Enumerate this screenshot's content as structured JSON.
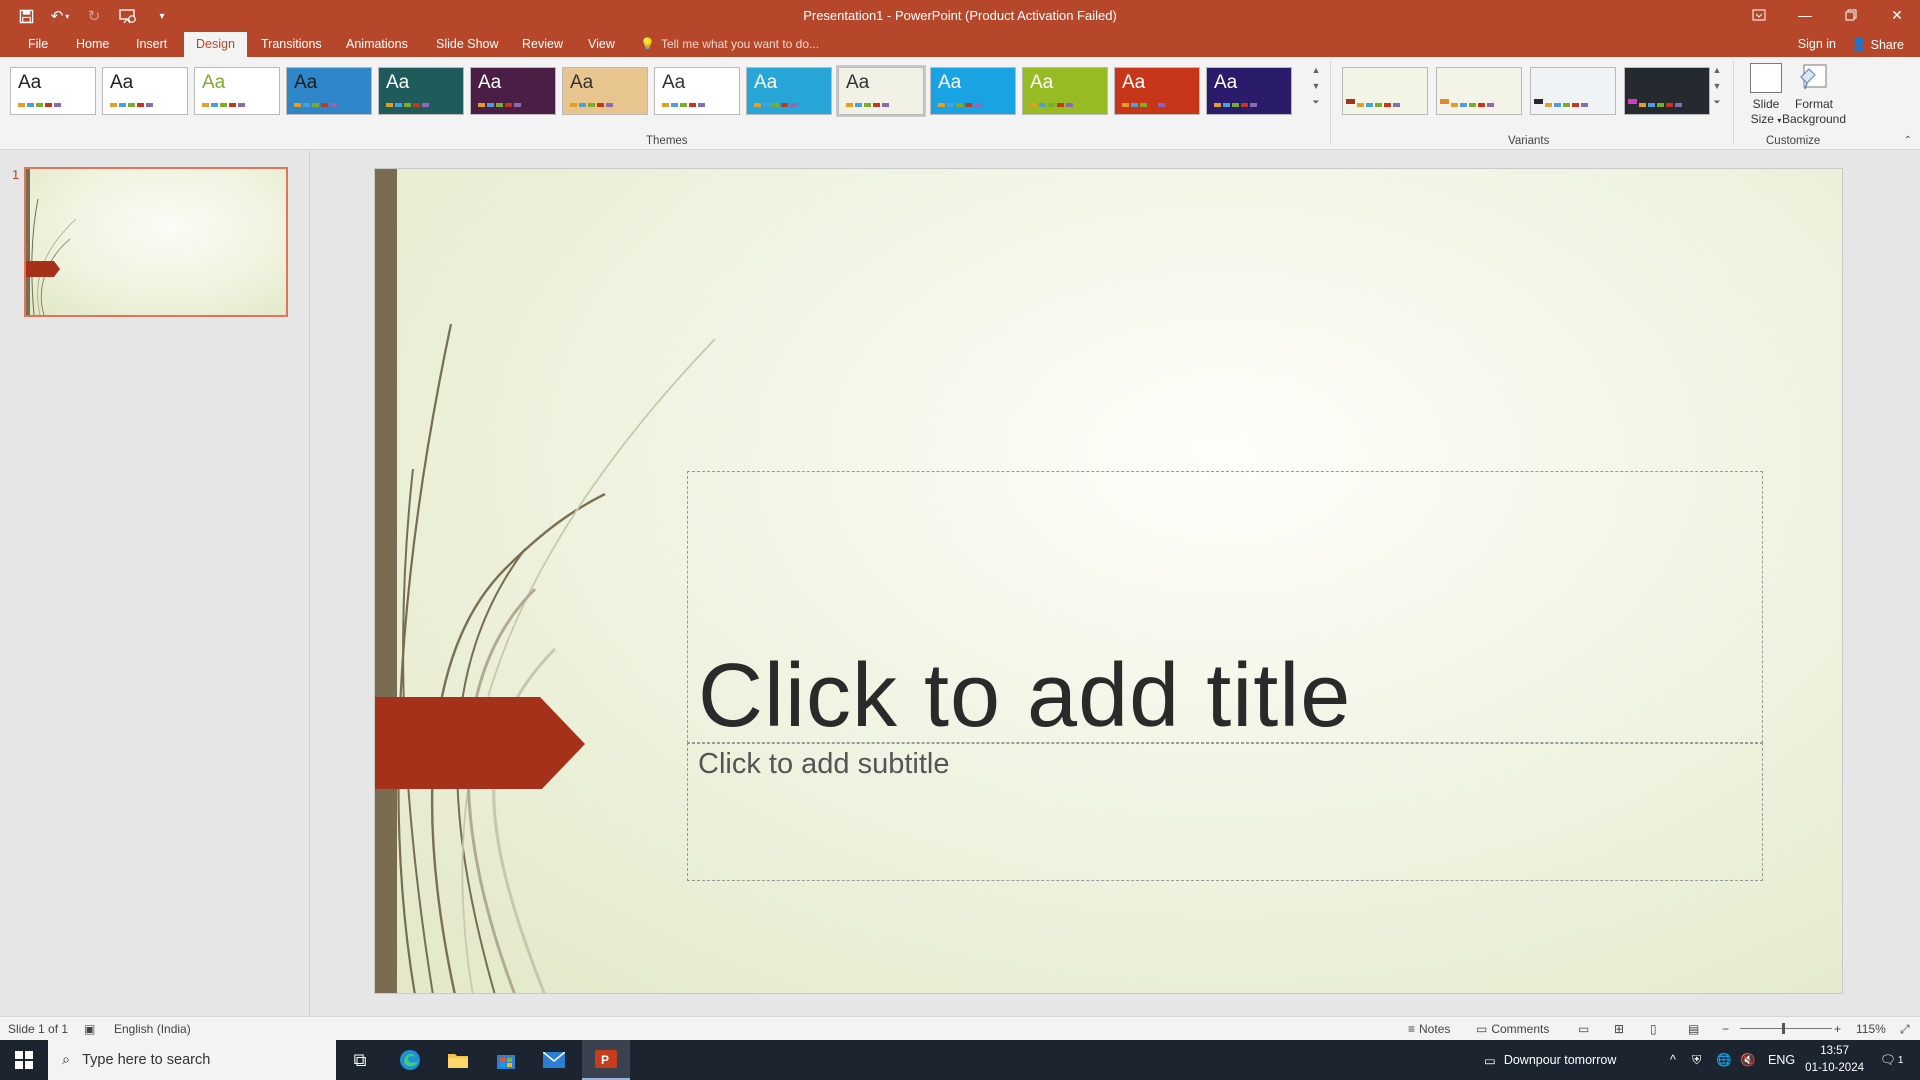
{
  "window": {
    "title": "Presentation1 - PowerPoint (Product Activation Failed)"
  },
  "tabs": [
    {
      "label": "File"
    },
    {
      "label": "Home"
    },
    {
      "label": "Insert"
    },
    {
      "label": "Design",
      "active": true
    },
    {
      "label": "Transitions"
    },
    {
      "label": "Animations"
    },
    {
      "label": "Slide Show"
    },
    {
      "label": "Review"
    },
    {
      "label": "View"
    }
  ],
  "tellme": {
    "placeholder": "Tell me what you want to do..."
  },
  "account": {
    "signin": "Sign in",
    "share": "Share"
  },
  "ribbon": {
    "themes_label": "Themes",
    "variants_label": "Variants",
    "customize_label": "Customize",
    "theme_sample": "Aa",
    "slide_size": "Slide Size",
    "format_background": "Format Background",
    "themes": [
      {
        "name": "office-theme",
        "bg": "#ffffff",
        "fg": "#222222"
      },
      {
        "name": "office",
        "bg": "#ffffff",
        "fg": "#222222"
      },
      {
        "name": "facet",
        "bg": "#ffffff",
        "fg": "#7dab2b"
      },
      {
        "name": "integral",
        "bg": "#2f86c9",
        "fg": "#1b1b1b"
      },
      {
        "name": "ion-boardroom",
        "bg": "#1f5b5b",
        "fg": "#ffffff"
      },
      {
        "name": "organic",
        "bg": "#4b1e46",
        "fg": "#ffffff"
      },
      {
        "name": "retrospect",
        "bg": "#e8c48f",
        "fg": "#333333"
      },
      {
        "name": "slice",
        "bg": "#ffffff",
        "fg": "#333333"
      },
      {
        "name": "wisp-blue",
        "bg": "#29a6d8",
        "fg": "#ffffff"
      },
      {
        "name": "wisp",
        "bg": "#f1f1e5",
        "fg": "#333333"
      },
      {
        "name": "banded",
        "bg": "#1aa3e3",
        "fg": "#ffffff"
      },
      {
        "name": "green",
        "bg": "#97bb23",
        "fg": "#ffffff"
      },
      {
        "name": "red-orange",
        "bg": "#c8361a",
        "fg": "#ffffff"
      },
      {
        "name": "dark-blue",
        "bg": "#2a1c6b",
        "fg": "#ffffff"
      }
    ],
    "variants": [
      {
        "bg": "#f2f4e6",
        "accent": "#a6331b"
      },
      {
        "bg": "#f4f3e8",
        "accent": "#e08b25"
      },
      {
        "bg": "#f0f3f5",
        "accent": "#2a2a2a"
      },
      {
        "bg": "#252a30",
        "accent": "#cf3dbf"
      }
    ]
  },
  "slidepane": {
    "slide_number": "1"
  },
  "slide": {
    "title_placeholder": "Click to add title",
    "subtitle_placeholder": "Click to add subtitle"
  },
  "status": {
    "slide_info": "Slide 1 of 1",
    "language": "English (India)",
    "notes": "Notes",
    "comments": "Comments",
    "zoom": "115%"
  },
  "taskbar": {
    "search_placeholder": "Type here to search",
    "weather": "Downpour tomorrow",
    "input_lang": "ENG",
    "time": "13:57",
    "date": "01-10-2024",
    "notification_count": "1"
  },
  "colors": {
    "accent": "#b7472a",
    "slide_bar": "#786d51",
    "arrow": "#a6311a"
  }
}
